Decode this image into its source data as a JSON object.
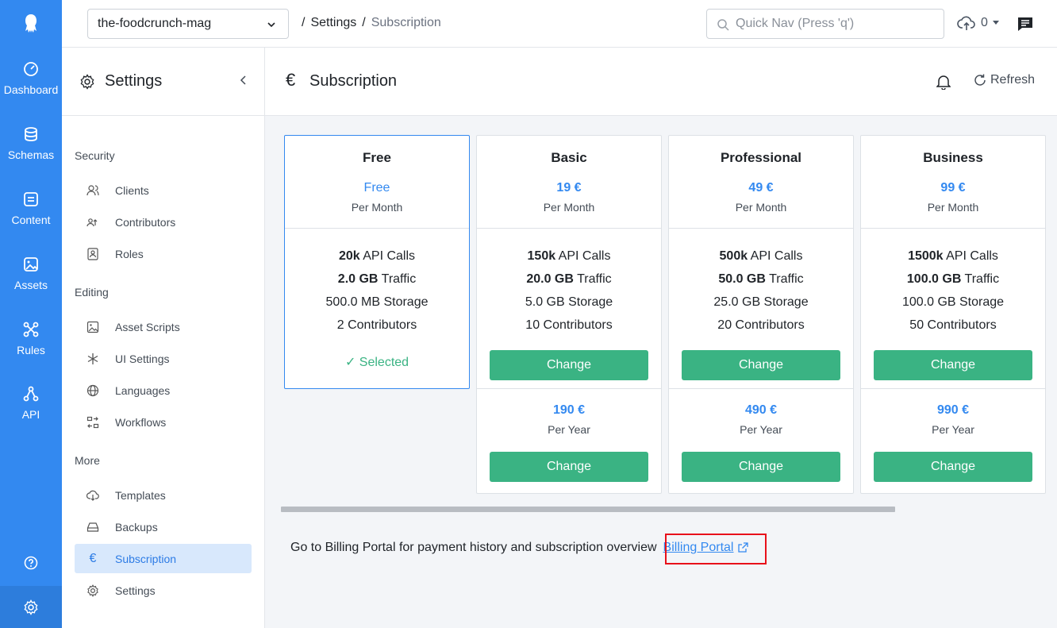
{
  "rail": {
    "items": [
      {
        "label": "Dashboard",
        "icon": "dashboard-icon"
      },
      {
        "label": "Schemas",
        "icon": "schemas-icon"
      },
      {
        "label": "Content",
        "icon": "content-icon"
      },
      {
        "label": "Assets",
        "icon": "assets-icon"
      },
      {
        "label": "Rules",
        "icon": "rules-icon"
      },
      {
        "label": "API",
        "icon": "api-icon"
      }
    ]
  },
  "topbar": {
    "app_name": "the-foodcrunch-mag",
    "breadcrumb_sep": "/",
    "breadcrumb_1": "Settings",
    "breadcrumb_2": "Subscription",
    "quicknav_placeholder": "Quick Nav (Press 'q')",
    "upload_count": "0"
  },
  "settings_panel": {
    "title": "Settings",
    "groups": [
      {
        "title": "Security",
        "items": [
          "Clients",
          "Contributors",
          "Roles"
        ]
      },
      {
        "title": "Editing",
        "items": [
          "Asset Scripts",
          "UI Settings",
          "Languages",
          "Workflows"
        ]
      },
      {
        "title": "More",
        "items": [
          "Templates",
          "Backups",
          "Subscription",
          "Settings"
        ]
      }
    ]
  },
  "main": {
    "title": "Subscription",
    "title_icon": "€",
    "refresh_label": "Refresh"
  },
  "plans": [
    {
      "name": "Free",
      "price": "Free",
      "per": "Per Month",
      "api": "20k",
      "api_suffix": " API Calls",
      "traffic": "2.0 GB",
      "traffic_suffix": " Traffic",
      "storage": "500.0 MB Storage",
      "contributors": "2 Contributors",
      "status": "✓ Selected"
    },
    {
      "name": "Basic",
      "price": "19 €",
      "per": "Per Month",
      "api": "150k",
      "api_suffix": " API Calls",
      "traffic": "20.0 GB",
      "traffic_suffix": " Traffic",
      "storage": "5.0 GB Storage",
      "contributors": "10 Contributors",
      "button": "Change",
      "year_price": "190 €",
      "year_per": "Per Year",
      "year_button": "Change"
    },
    {
      "name": "Professional",
      "price": "49 €",
      "per": "Per Month",
      "api": "500k",
      "api_suffix": " API Calls",
      "traffic": "50.0 GB",
      "traffic_suffix": " Traffic",
      "storage": "25.0 GB Storage",
      "contributors": "20 Contributors",
      "button": "Change",
      "year_price": "490 €",
      "year_per": "Per Year",
      "year_button": "Change"
    },
    {
      "name": "Business",
      "price": "99 €",
      "per": "Per Month",
      "api": "1500k",
      "api_suffix": " API Calls",
      "traffic": "100.0 GB",
      "traffic_suffix": " Traffic",
      "storage": "100.0 GB Storage",
      "contributors": "50 Contributors",
      "button": "Change",
      "year_price": "990 €",
      "year_per": "Per Year",
      "year_button": "Change"
    }
  ],
  "billing": {
    "text": "Go to Billing Portal for payment history and subscription overview",
    "link_label": "Billing Portal"
  },
  "colors": {
    "accent": "#3389f0",
    "success": "#3ab383",
    "highlight": "#e8101a"
  }
}
